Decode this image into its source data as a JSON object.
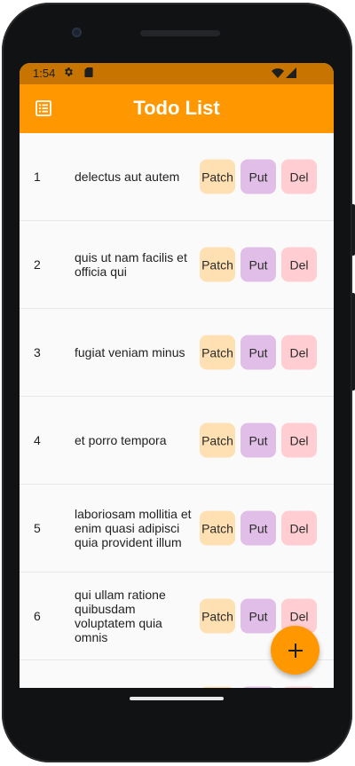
{
  "statusbar": {
    "time": "1:54",
    "icons": [
      "settings-icon",
      "sd-card-icon",
      "wifi-icon",
      "signal-icon"
    ]
  },
  "appbar": {
    "title": "Todo List",
    "icon": "list-icon",
    "color": "#ff9800"
  },
  "todos": [
    {
      "id": "1",
      "title": "delectus aut autem"
    },
    {
      "id": "2",
      "title": "quis ut nam facilis et officia qui"
    },
    {
      "id": "3",
      "title": "fugiat veniam minus"
    },
    {
      "id": "4",
      "title": "et porro tempora"
    },
    {
      "id": "5",
      "title": "laboriosam mollitia et enim quasi adipisci quia provident illum"
    },
    {
      "id": "6",
      "title": "qui ullam ratione quibusdam voluptatem quia omnis"
    },
    {
      "id": "",
      "title": ""
    }
  ],
  "actions": {
    "patch_label": "Patch",
    "put_label": "Put",
    "del_label": "Del",
    "patch_color": "#ffe0b2",
    "put_color": "#e1bee7",
    "del_color": "#ffcdd2"
  },
  "fab": {
    "icon": "plus-icon"
  }
}
